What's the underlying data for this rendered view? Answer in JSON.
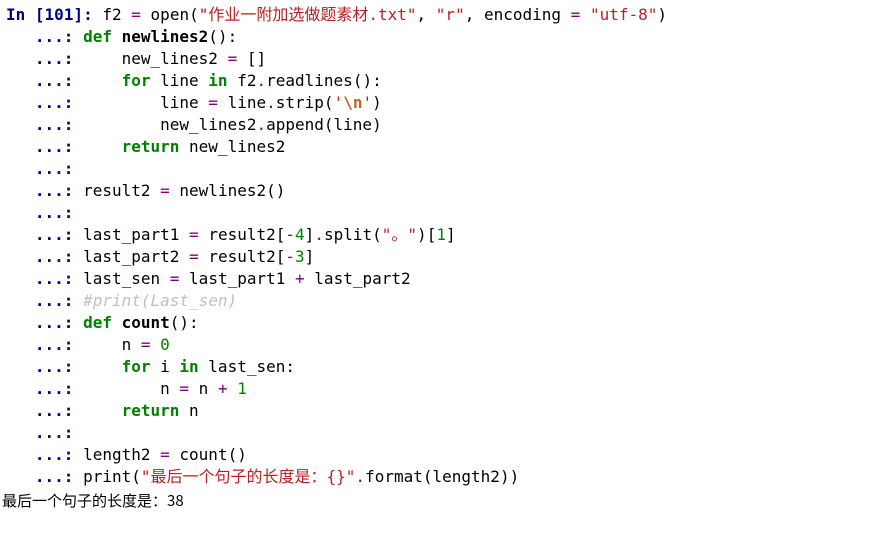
{
  "chart_data": {
    "type": "table",
    "categories": [
      "line"
    ],
    "series": [
      {
        "name": "code",
        "values": [
          "f2 = open(\"作业一附加选做题素材.txt\", \"r\", encoding = \"utf-8\")",
          "def newlines2():",
          "    new_lines2 = []",
          "    for line in f2.readlines():",
          "        line = line.strip('\\n')",
          "        new_lines2.append(line)",
          "    return new_lines2",
          "",
          "result2 = newlines2()",
          "",
          "last_part1 = result2[-4].split(\"。\")[1]",
          "last_part2 = result2[-3]",
          "last_sen = last_part1 + last_part2",
          "#print(Last_sen)",
          "def count():",
          "    n = 0",
          "    for i in last_sen:",
          "        n = n + 1",
          "    return n",
          "",
          "length2 = count()",
          "print(\"最后一个句子的长度是：{}\".format(length2))"
        ]
      }
    ]
  },
  "prompt": {
    "label": "In ",
    "num": "101",
    "open": "[",
    "close": "]:",
    "cont": "   ...: "
  },
  "code": {
    "l0": {
      "a": "f2 ",
      "eq": "=",
      "sp": " ",
      "open": "open",
      "lp": "(",
      "s1": "\"作业一附加选做题素材.txt\"",
      "c1": ", ",
      "s2": "\"r\"",
      "c2": ", ",
      "enc": "encoding ",
      "eq2": "=",
      "sp2": " ",
      "s3": "\"utf-8\"",
      "rp": ")"
    },
    "l1": {
      "def": "def ",
      "name": "newlines2",
      "paren": "():"
    },
    "l2": {
      "ind": "    ",
      "v": "new_lines2 ",
      "eq": "=",
      "sp": " ",
      "br": "[]"
    },
    "l3": {
      "ind": "    ",
      "for": "for ",
      "var": "line ",
      "in": "in ",
      "obj": "f2",
      "dot": ".",
      "m": "readlines",
      "call": "():"
    },
    "l4": {
      "ind": "        ",
      "v": "line ",
      "eq": "=",
      "sp": " ",
      "obj": "line",
      "dot": ".",
      "m": "strip",
      "lp": "(",
      "so": "'",
      "esc": "\\n",
      "sc": "'",
      "rp": ")"
    },
    "l5": {
      "ind": "        ",
      "obj": "new_lines2",
      "dot": ".",
      "m": "append",
      "lp": "(",
      "arg": "line",
      "rp": ")"
    },
    "l6": {
      "ind": "    ",
      "ret": "return ",
      "v": "new_lines2"
    },
    "l7": {
      "blank": ""
    },
    "l8": {
      "v": "result2 ",
      "eq": "=",
      "sp": " ",
      "fn": "newlines2",
      "call": "()"
    },
    "l9": {
      "blank": ""
    },
    "l10": {
      "v": "last_part1 ",
      "eq": "=",
      "sp": " ",
      "obj": "result2",
      "lb": "[",
      "neg": "-",
      "n": "4",
      "rb": "]",
      "dot": ".",
      "m": "split",
      "lp": "(",
      "s": "\"。\"",
      "rp": ")",
      "lb2": "[",
      "n2": "1",
      "rb2": "]"
    },
    "l11": {
      "v": "last_part2 ",
      "eq": "=",
      "sp": " ",
      "obj": "result2",
      "lb": "[",
      "neg": "-",
      "n": "3",
      "rb": "]"
    },
    "l12": {
      "v": "last_sen ",
      "eq": "=",
      "sp": " ",
      "a": "last_part1 ",
      "plus": "+",
      "sp2": " ",
      "b": "last_part2"
    },
    "l13": {
      "c": "#print(Last_sen)"
    },
    "l14": {
      "def": "def ",
      "name": "count",
      "paren": "():"
    },
    "l15": {
      "ind": "    ",
      "v": "n ",
      "eq": "=",
      "sp": " ",
      "n": "0"
    },
    "l16": {
      "ind": "    ",
      "for": "for ",
      "var": "i ",
      "in": "in ",
      "obj": "last_sen",
      "colon": ":"
    },
    "l17": {
      "ind": "        ",
      "v": "n ",
      "eq": "=",
      "sp": " ",
      "a": "n ",
      "plus": "+",
      "sp2": " ",
      "n": "1"
    },
    "l18": {
      "ind": "    ",
      "ret": "return ",
      "v": "n"
    },
    "l19": {
      "blank": ""
    },
    "l20": {
      "v": "length2 ",
      "eq": "=",
      "sp": " ",
      "fn": "count",
      "call": "()"
    },
    "l21": {
      "p": "print",
      "lp": "(",
      "s": "\"最后一个句子的长度是：{}\"",
      "dot": ".",
      "m": "format",
      "lp2": "(",
      "arg": "length2",
      "rp2": ")",
      "rp": ")"
    }
  },
  "output": {
    "text": "最后一个句子的长度是：38"
  }
}
